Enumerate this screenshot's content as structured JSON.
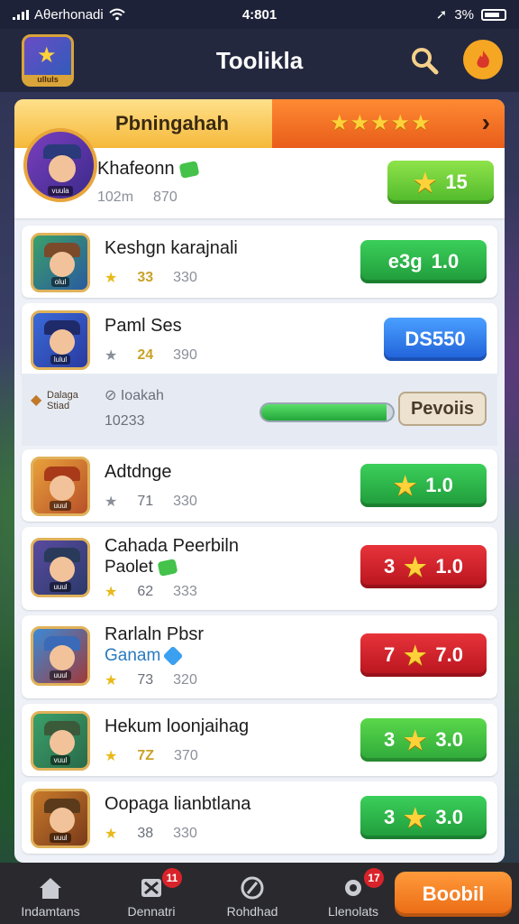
{
  "status": {
    "carrier": "Aθerhonadi",
    "time": "4:801",
    "battery": "3%"
  },
  "header": {
    "logo_label": "ulluls",
    "title": "Toolikla"
  },
  "panel": {
    "tab_title": "Pbningahah",
    "tab_stars": "★★★★★"
  },
  "rows": [
    {
      "name": "Khafeonn",
      "meta_a": "102m",
      "meta_b": "870",
      "button": "15",
      "button_star": "★",
      "avatar_tag": "vuula"
    },
    {
      "name": "Keshgn karajnali",
      "meta_a": "33",
      "meta_b": "330",
      "button_prefix": "e3g",
      "button": "1.0",
      "avatar_tag": "olul"
    },
    {
      "name": "Paml Ses",
      "meta_a": "24",
      "meta_b": "390",
      "button": "DS550",
      "avatar_tag": "lulul"
    },
    {
      "name": "Adtdnge",
      "meta_a": "71",
      "meta_b": "330",
      "button": "1.0",
      "button_star": "★",
      "avatar_tag": "uuul"
    },
    {
      "name": "Cahada Peerbiln",
      "name2": "Paolet",
      "meta_a": "62",
      "meta_b": "333",
      "button_prefix": "3",
      "button": "1.0",
      "button_star": "★",
      "avatar_tag": "uuul"
    },
    {
      "name": "Rarlaln Pbsr",
      "name2": "Ganam",
      "meta_a": "73",
      "meta_b": "320",
      "button_prefix": "7",
      "button": "7.0",
      "button_star": "★",
      "avatar_tag": "uuul"
    },
    {
      "name": "Hekum loonjaihag",
      "meta_a": "7Z",
      "meta_b": "370",
      "button_prefix": "3",
      "button": "3.0",
      "button_star": "★",
      "avatar_tag": "vuul"
    },
    {
      "name": "Oopaga lianbtlana",
      "meta_a": "38",
      "meta_b": "330",
      "button_prefix": "3",
      "button": "3.0",
      "button_star": "★",
      "avatar_tag": "uuul"
    }
  ],
  "progress": {
    "logo_text": "Dalaga Stiad",
    "name": "Ioakah",
    "value": "10233",
    "button": "Pevoiis",
    "fill": 0.95
  },
  "nav": [
    {
      "label": "Indamtans"
    },
    {
      "label": "Dennatri",
      "count": "11"
    },
    {
      "label": "Rohdhad"
    },
    {
      "label": "Llenolats",
      "count": "17"
    }
  ],
  "cta": "Boobil",
  "colors": {
    "accent": "#ff8a33",
    "green": "#1f9a3a",
    "red": "#b8141e",
    "blue": "#1f5fd8"
  }
}
